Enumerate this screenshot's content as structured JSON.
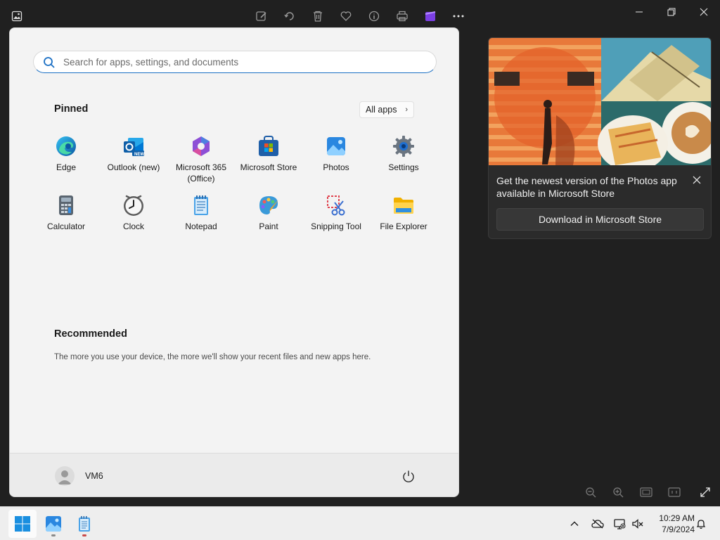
{
  "photos_app": {
    "promo": {
      "message": "Get the newest version of the Photos app available in Microsoft Store",
      "button_label": "Download in Microsoft Store"
    }
  },
  "start_menu": {
    "search": {
      "placeholder": "Search for apps, settings, and documents"
    },
    "pinned_title": "Pinned",
    "all_apps_label": "All apps",
    "all_apps_chevron": "›",
    "apps": [
      {
        "label": "Edge",
        "icon": "edge-icon"
      },
      {
        "label": "Outlook (new)",
        "icon": "outlook-icon",
        "badge": "NEW"
      },
      {
        "label": "Microsoft 365\n(Office)",
        "icon": "office-icon"
      },
      {
        "label": "Microsoft Store",
        "icon": "store-icon"
      },
      {
        "label": "Photos",
        "icon": "photos-icon"
      },
      {
        "label": "Settings",
        "icon": "settings-icon"
      },
      {
        "label": "Calculator",
        "icon": "calculator-icon"
      },
      {
        "label": "Clock",
        "icon": "clock-icon"
      },
      {
        "label": "Notepad",
        "icon": "notepad-icon"
      },
      {
        "label": "Paint",
        "icon": "paint-icon"
      },
      {
        "label": "Snipping Tool",
        "icon": "snipping-tool-icon"
      },
      {
        "label": "File Explorer",
        "icon": "file-explorer-icon"
      }
    ],
    "recommended_title": "Recommended",
    "recommended_text": "The more you use your device, the more we'll show your recent files and new apps here.",
    "user_name": "VM6"
  },
  "taskbar": {
    "time": "10:29 AM",
    "date": "7/9/2024"
  },
  "colors": {
    "accent": "#0067c0",
    "start_bg": "#f3f3f3",
    "app_bg": "#202020"
  }
}
